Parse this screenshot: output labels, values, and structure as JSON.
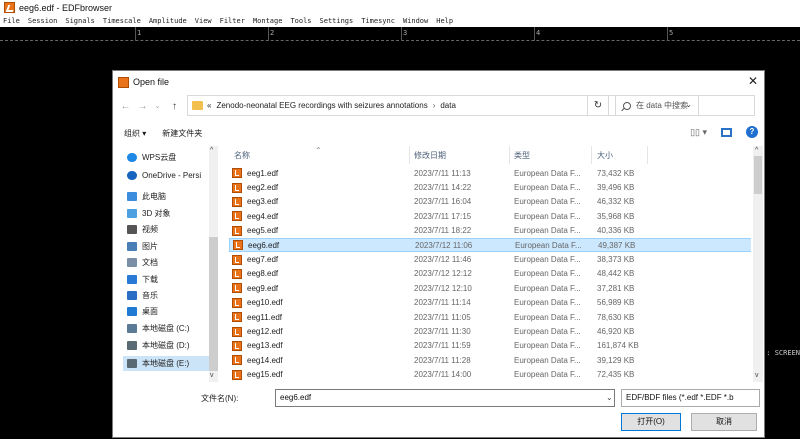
{
  "app": {
    "title": "eeg6.edf - EDFbrowser",
    "menu": [
      "File",
      "Session",
      "Signals",
      "Timescale",
      "Amplitude",
      "View",
      "Filter",
      "Montage",
      "Tools",
      "Settings",
      "Timesync",
      "Window",
      "Help"
    ],
    "ruler_ticks": [
      "1",
      "2",
      "3",
      "4",
      "5"
    ],
    "side_label": ": SCREEN"
  },
  "dialog": {
    "title": "Open file",
    "close_glyph": "✕",
    "nav": {
      "back": "←",
      "forward": "→",
      "recent": "⌄",
      "up": "↑"
    },
    "breadcrumb": {
      "prefix": "«",
      "parent": "Zenodo-neonatal EEG recordings with seizures annotations",
      "separator": "›",
      "current": "data"
    },
    "refresh_glyph": "↻",
    "search_placeholder": "在 data 中搜索",
    "toolbar": {
      "organize": "组织 ▾",
      "new_folder": "新建文件夹",
      "view_glyph": "▯▯ ▾",
      "help_glyph": "?"
    },
    "nav_pane": [
      {
        "label": "WPS云盘",
        "icon": "cloud-icon",
        "color": "#1e88e5"
      },
      {
        "label": "OneDrive - Persi",
        "icon": "onedrive-icon",
        "color": "#1565c0"
      },
      {
        "label": "此电脑",
        "icon": "computer-icon",
        "color": "#3c8dde"
      },
      {
        "label": "3D 对象",
        "icon": "cube-icon",
        "color": "#4aa0e0"
      },
      {
        "label": "视频",
        "icon": "video-icon",
        "color": "#555555"
      },
      {
        "label": "图片",
        "icon": "picture-icon",
        "color": "#4a7fb5"
      },
      {
        "label": "文档",
        "icon": "document-icon",
        "color": "#7a8fa6"
      },
      {
        "label": "下载",
        "icon": "download-icon",
        "color": "#2979d6"
      },
      {
        "label": "音乐",
        "icon": "music-icon",
        "color": "#2b6cc4"
      },
      {
        "label": "桌面",
        "icon": "desktop-icon",
        "color": "#1f7ad4"
      },
      {
        "label": "本地磁盘 (C:)",
        "icon": "drive-c-icon",
        "color": "#5a7a95"
      },
      {
        "label": "本地磁盘 (D:)",
        "icon": "drive-d-icon",
        "color": "#5a6a75"
      },
      {
        "label": "本地磁盘 (E:)",
        "icon": "drive-e-icon",
        "color": "#5a6a75"
      }
    ],
    "columns": {
      "name": "名称",
      "modified": "修改日期",
      "type": "类型",
      "size": "大小"
    },
    "files": [
      {
        "name": "eeg1.edf",
        "modified": "2023/7/11 11:13",
        "type": "European Data F...",
        "size": "73,432 KB"
      },
      {
        "name": "eeg2.edf",
        "modified": "2023/7/11 14:22",
        "type": "European Data F...",
        "size": "39,496 KB"
      },
      {
        "name": "eeg3.edf",
        "modified": "2023/7/11 16:04",
        "type": "European Data F...",
        "size": "46,332 KB"
      },
      {
        "name": "eeg4.edf",
        "modified": "2023/7/11 17:15",
        "type": "European Data F...",
        "size": "35,968 KB"
      },
      {
        "name": "eeg5.edf",
        "modified": "2023/7/11 18:22",
        "type": "European Data F...",
        "size": "40,336 KB"
      },
      {
        "name": "eeg6.edf",
        "modified": "2023/7/12 11:06",
        "type": "European Data F...",
        "size": "49,387 KB",
        "selected": true
      },
      {
        "name": "eeg7.edf",
        "modified": "2023/7/12 11:46",
        "type": "European Data F...",
        "size": "38,373 KB"
      },
      {
        "name": "eeg8.edf",
        "modified": "2023/7/12 12:12",
        "type": "European Data F...",
        "size": "48,442 KB"
      },
      {
        "name": "eeg9.edf",
        "modified": "2023/7/12 12:10",
        "type": "European Data F...",
        "size": "37,281 KB"
      },
      {
        "name": "eeg10.edf",
        "modified": "2023/7/11 11:14",
        "type": "European Data F...",
        "size": "56,989 KB"
      },
      {
        "name": "eeg11.edf",
        "modified": "2023/7/11 11:05",
        "type": "European Data F...",
        "size": "78,630 KB"
      },
      {
        "name": "eeg12.edf",
        "modified": "2023/7/11 11:30",
        "type": "European Data F...",
        "size": "46,920 KB"
      },
      {
        "name": "eeg13.edf",
        "modified": "2023/7/11 11:59",
        "type": "European Data F...",
        "size": "161,874 KB"
      },
      {
        "name": "eeg14.edf",
        "modified": "2023/7/11 11:28",
        "type": "European Data F...",
        "size": "39,129 KB"
      },
      {
        "name": "eeg15.edf",
        "modified": "2023/7/11 14:00",
        "type": "European Data F...",
        "size": "72,435 KB"
      }
    ],
    "filename_label": "文件名(N):",
    "filename_value": "eeg6.edf",
    "filetype": "EDF/BDF files (*.edf *.EDF *.b",
    "open_label": "打开(O)",
    "cancel_label": "取消",
    "colors": {
      "selection_bg": "#cce8ff",
      "nav_selection_bg": "#cce4f7",
      "accent": "#0078d7",
      "file_icon": "#e8731a"
    }
  }
}
